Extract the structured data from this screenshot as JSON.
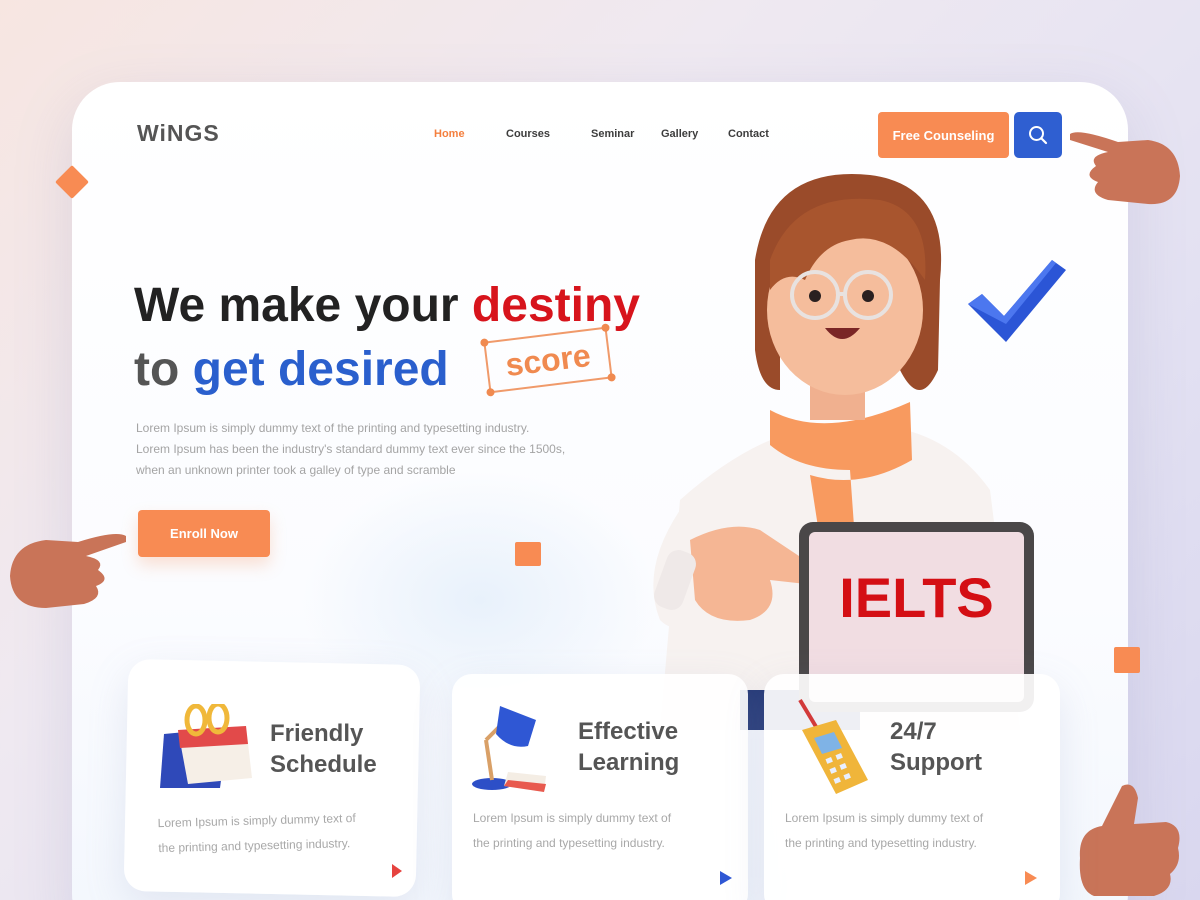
{
  "brand": {
    "logo": "WiNGS"
  },
  "nav": {
    "items": [
      "Home",
      "Courses",
      "Seminar",
      "Gallery",
      "Contact"
    ],
    "active": "Home"
  },
  "header": {
    "cta_label": "Free Counseling",
    "search_icon": "search-icon"
  },
  "hero": {
    "line1_prefix": "We make your ",
    "line1_highlight": "destiny",
    "line2_prefix": "to ",
    "line2_highlight": "get desired",
    "boxed_word": "score",
    "description_lines": [
      "Lorem Ipsum is simply dummy text of the printing and typesetting industry.",
      "Lorem Ipsum has been the industry's standard dummy text ever since the 1500s,",
      "when an unknown printer took a galley of type and scramble"
    ],
    "cta_label": "Enroll Now",
    "tablet_text": "IELTS"
  },
  "features": [
    {
      "title_line1": "Friendly",
      "title_line2": "Schedule",
      "text_line1": "Lorem Ipsum is simply dummy text of",
      "text_line2": "the printing and typesetting industry.",
      "icon": "calendar-icon"
    },
    {
      "title_line1": "Effective",
      "title_line2": "Learning",
      "text_line1": "Lorem Ipsum is simply dummy text of",
      "text_line2": "the printing and typesetting industry.",
      "icon": "desk-lamp-icon"
    },
    {
      "title_line1": "24/7",
      "title_line2": "Support",
      "text_line1": "Lorem Ipsum is simply dummy text of",
      "text_line2": "the printing and typesetting industry.",
      "icon": "phone-icon"
    }
  ],
  "colors": {
    "accent_orange": "#f88b53",
    "accent_blue": "#2f5fd1",
    "accent_red": "#d7141c"
  }
}
